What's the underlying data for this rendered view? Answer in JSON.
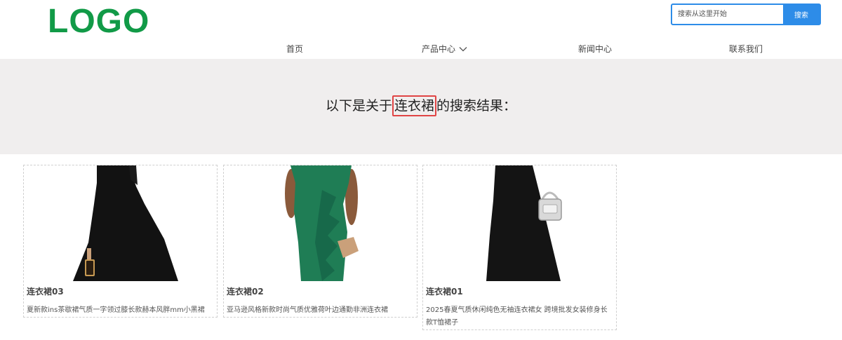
{
  "header": {
    "logo": "LOGO",
    "search_placeholder": "搜索从这里开始",
    "search_button": "搜索"
  },
  "nav": {
    "items": [
      {
        "label": "首页"
      },
      {
        "label": "产品中心"
      },
      {
        "label": "新闻中心"
      },
      {
        "label": "联系我们"
      }
    ]
  },
  "banner": {
    "prefix": "以下是关于",
    "keyword": "连衣裙",
    "suffix": "的搜索结果："
  },
  "results": [
    {
      "title": "连衣裙03",
      "desc": "夏新款ins茶歇裙气质一字领过膝长款赫本风胖mm小黑裙",
      "dress_color": "#121212",
      "image": "black-dress-image"
    },
    {
      "title": "连衣裙02",
      "desc": "亚马逊风格新款时尚气质优雅荷叶边通勤非洲连衣裙",
      "dress_color": "#1f7d55",
      "image": "green-dress-image"
    },
    {
      "title": "连衣裙01",
      "desc": "2025春夏气质休闲纯色无袖连衣裙女 跨境批发女装修身长款T恤裙子",
      "dress_color": "#141414",
      "image": "black-dress-handbag-image"
    }
  ]
}
